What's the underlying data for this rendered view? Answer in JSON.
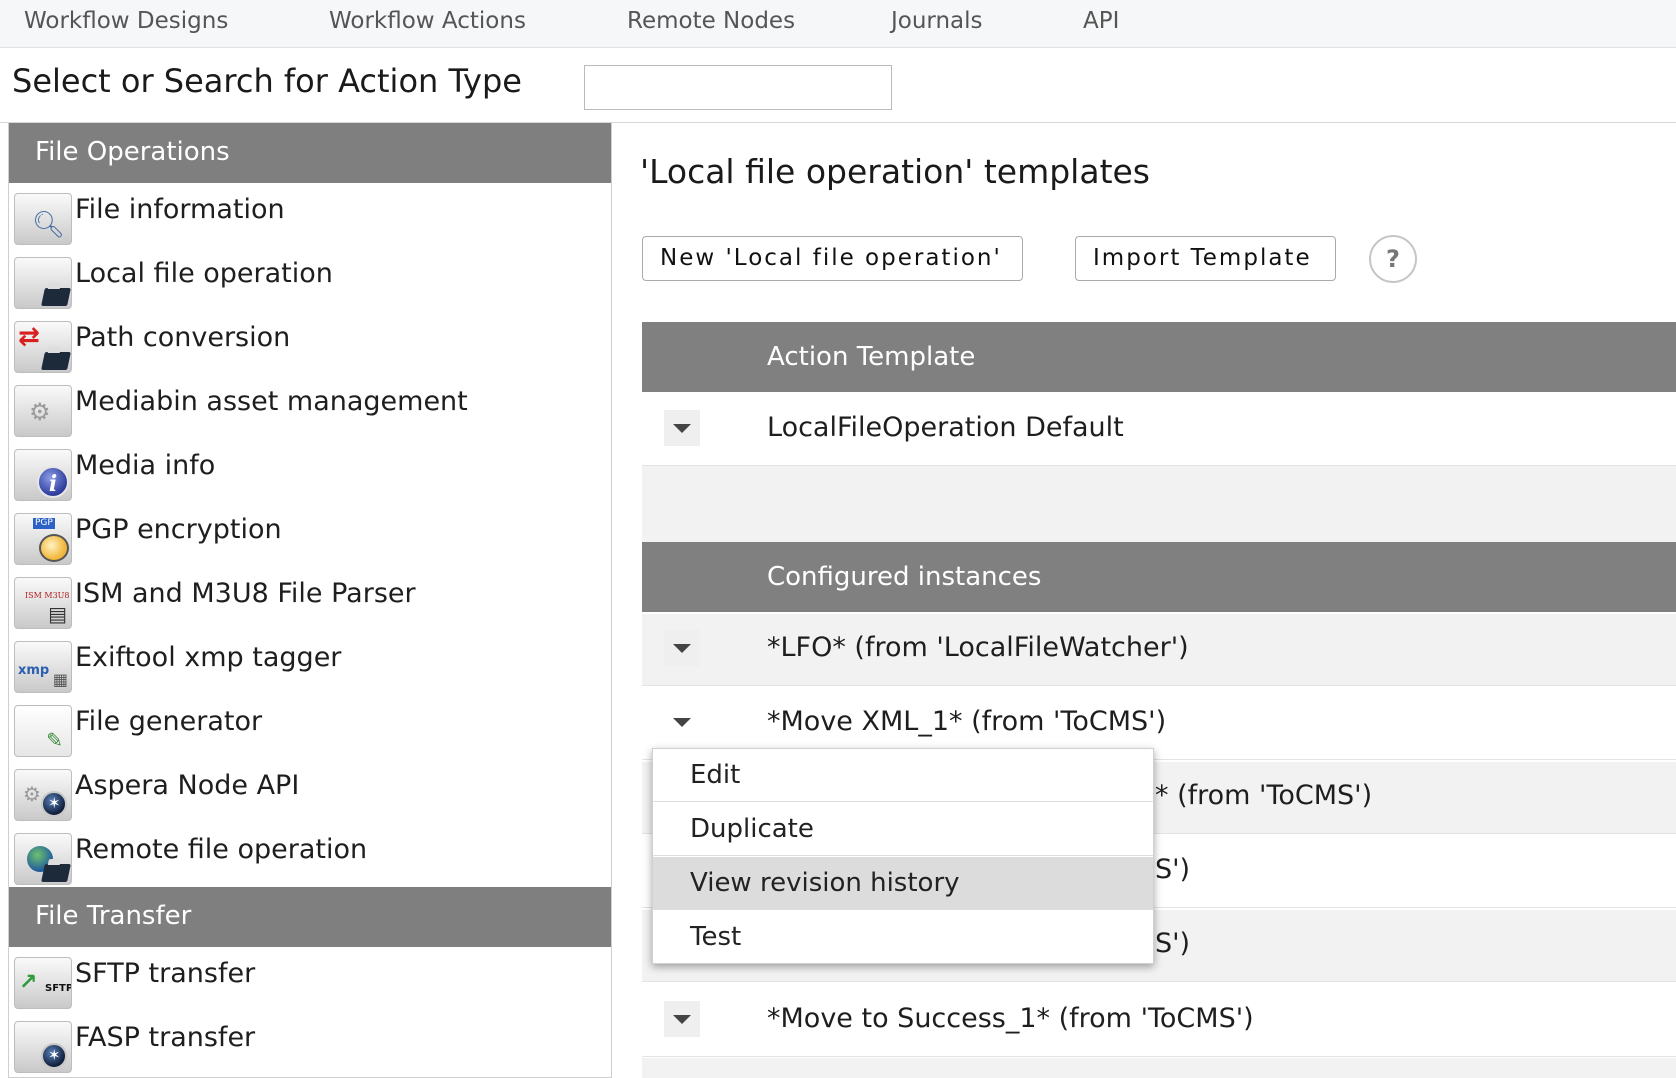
{
  "nav": {
    "items": [
      "Workflow Designs",
      "Workflow Actions",
      "Remote Nodes",
      "Journals",
      "API"
    ]
  },
  "search": {
    "title": "Select or Search for Action Type",
    "value": "",
    "placeholder": ""
  },
  "sidebar": {
    "categories": [
      {
        "label": "File Operations",
        "items": [
          {
            "label": "File information",
            "icon": "file-information-icon"
          },
          {
            "label": "Local file operation",
            "icon": "local-file-operation-icon"
          },
          {
            "label": "Path conversion",
            "icon": "path-conversion-icon"
          },
          {
            "label": "Mediabin asset management",
            "icon": "mediabin-icon"
          },
          {
            "label": "Media info",
            "icon": "media-info-icon"
          },
          {
            "label": "PGP encryption",
            "icon": "pgp-encryption-icon",
            "icon_text": "PGP"
          },
          {
            "label": "ISM and M3U8 File Parser",
            "icon": "ism-m3u8-parser-icon",
            "icon_text": "ISM M3U8"
          },
          {
            "label": "Exiftool xmp tagger",
            "icon": "exiftool-xmp-icon",
            "icon_text": "xmp"
          },
          {
            "label": "File generator",
            "icon": "file-generator-icon"
          },
          {
            "label": "Aspera Node API",
            "icon": "aspera-node-api-icon"
          },
          {
            "label": "Remote file operation",
            "icon": "remote-file-operation-icon"
          }
        ]
      },
      {
        "label": "File Transfer",
        "items": [
          {
            "label": "SFTP transfer",
            "icon": "sftp-transfer-icon",
            "icon_text": "SFTP"
          },
          {
            "label": "FASP transfer",
            "icon": "fasp-transfer-icon"
          }
        ]
      }
    ]
  },
  "main": {
    "title": "'Local file operation' templates",
    "new_button": "New 'Local file operation'",
    "import_button": "Import Template",
    "help_label": "?",
    "template_header": "Action Template",
    "templates": [
      "LocalFileOperation Default"
    ],
    "instances_header": "Configured instances",
    "instances": [
      "*LFO* (from 'LocalFileWatcher')",
      "*Move XML_1* (from 'ToCMS')",
      "* (from 'ToCMS')",
      "S')",
      "S')",
      "*Move to Success_1* (from 'ToCMS')"
    ]
  },
  "context_menu": {
    "items": [
      "Edit",
      "Duplicate",
      "View revision history",
      "Test"
    ],
    "hovered": "View revision history"
  },
  "colors": {
    "header_gray": "#808080",
    "nav_bg": "#f6f7f9",
    "menu_hover": "#dcdcdc"
  }
}
